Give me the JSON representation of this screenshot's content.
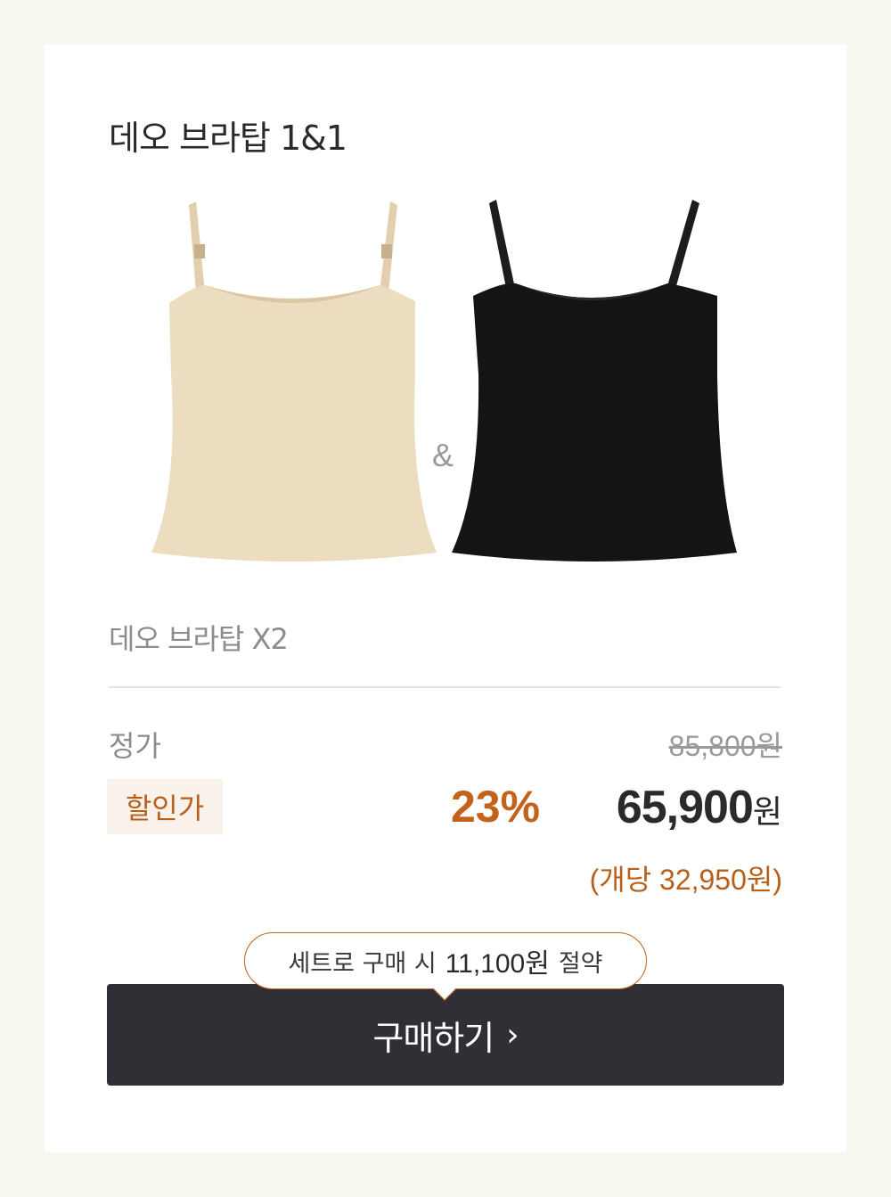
{
  "product": {
    "title": "데오 브라탑 1&1",
    "ampersand": "&",
    "subname": "데오 브라탑 X2",
    "items": [
      {
        "color_name": "beige",
        "color": "#ecdcc0"
      },
      {
        "color_name": "black",
        "color": "#141414"
      }
    ]
  },
  "pricing": {
    "regular_label": "정가",
    "regular_price": "85,800원",
    "sale_label": "할인가",
    "discount_percent": "23%",
    "sale_price": "65,900",
    "sale_unit": "원",
    "per_unit": "(개당 32,950원)"
  },
  "tooltip": {
    "prefix": "세트로 구매 시",
    "amount": "11,100원",
    "suffix": "절약"
  },
  "cta": {
    "label": "구매하기",
    "chevron": "›"
  },
  "colors": {
    "accent": "#c2621b",
    "button": "#2f2f35",
    "background": "#f7f6ef"
  }
}
